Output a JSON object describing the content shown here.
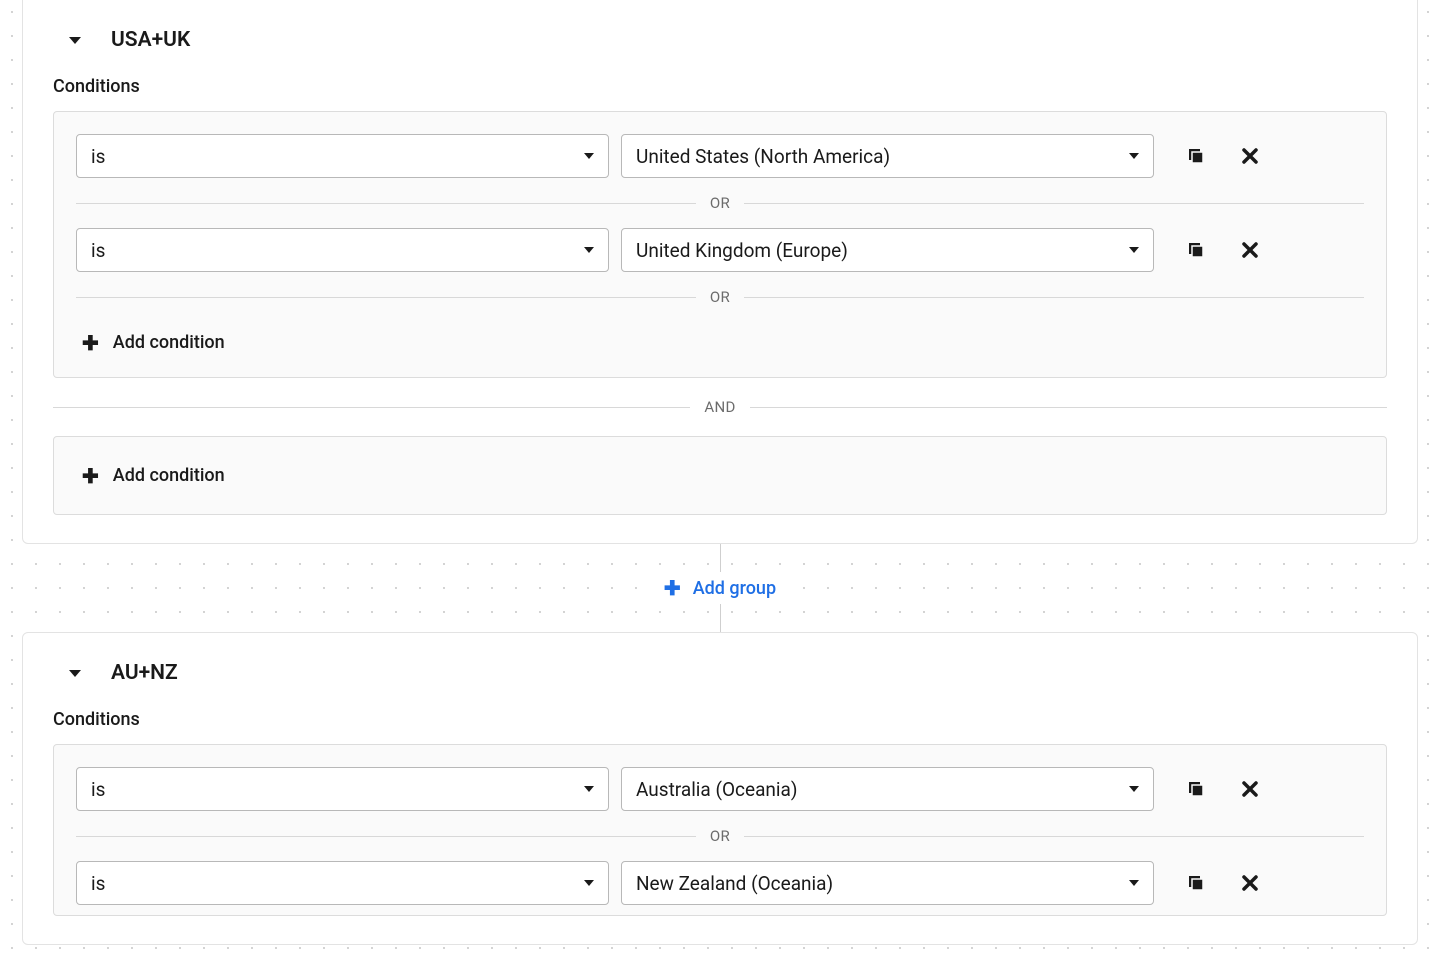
{
  "labels": {
    "conditions": "Conditions",
    "or": "OR",
    "and": "AND",
    "add_condition": "Add condition",
    "add_group": "Add group"
  },
  "groups": [
    {
      "title": "USA+UK",
      "condition_sets": [
        {
          "rows": [
            {
              "operator": "is",
              "value": "United States (North America)"
            },
            {
              "operator": "is",
              "value": "United Kingdom (Europe)"
            }
          ]
        },
        {
          "rows": []
        }
      ]
    },
    {
      "title": "AU+NZ",
      "condition_sets": [
        {
          "rows": [
            {
              "operator": "is",
              "value": "Australia (Oceania)"
            },
            {
              "operator": "is",
              "value": "New Zealand (Oceania)"
            }
          ]
        }
      ]
    }
  ]
}
